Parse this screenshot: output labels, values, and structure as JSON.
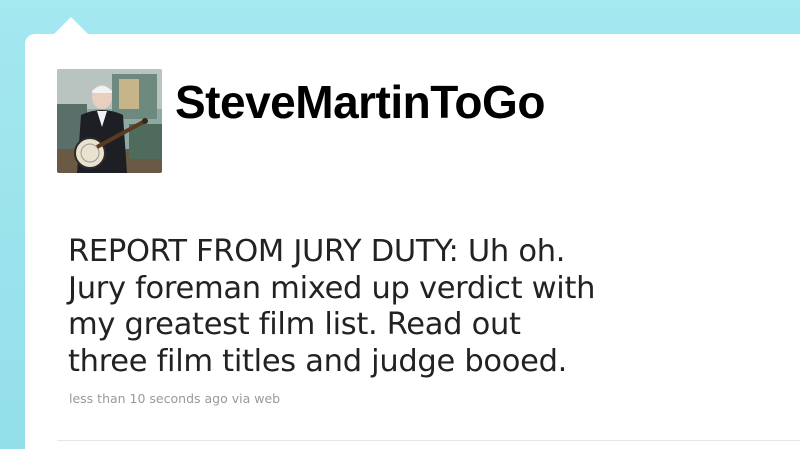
{
  "tweet": {
    "screen_name": "SteveMartinToGo",
    "text_lines": [
      "REPORT FROM JURY DUTY: Uh oh.",
      "Jury foreman mixed up verdict with",
      "my greatest film list. Read out",
      "three film titles and judge booed."
    ],
    "timestamp": "less than 10 seconds ago",
    "via_separator": "via",
    "source": "web"
  },
  "colors": {
    "page_background": "#9ae3ec",
    "card_background": "#ffffff",
    "text": "#222222",
    "meta": "#999999"
  }
}
